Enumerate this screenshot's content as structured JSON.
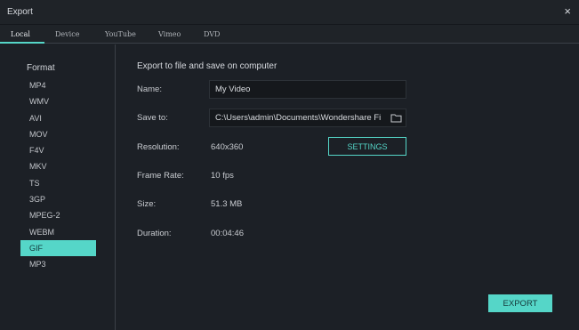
{
  "window": {
    "title": "Export",
    "close_glyph": "×"
  },
  "tabs": [
    {
      "label": "Local",
      "active": true
    },
    {
      "label": "Device",
      "active": false
    },
    {
      "label": "YouTube",
      "active": false
    },
    {
      "label": "Vimeo",
      "active": false
    },
    {
      "label": "DVD",
      "active": false
    }
  ],
  "sidebar": {
    "heading": "Format",
    "formats": [
      "MP4",
      "WMV",
      "AVI",
      "MOV",
      "F4V",
      "MKV",
      "TS",
      "3GP",
      "MPEG-2",
      "WEBM",
      "GIF",
      "MP3"
    ],
    "selected": "GIF"
  },
  "main": {
    "section_title": "Export to file and save on computer",
    "name": {
      "label": "Name:",
      "value": "My Video"
    },
    "save_to": {
      "label": "Save to:",
      "value": "C:\\Users\\admin\\Documents\\Wondershare Fil"
    },
    "resolution": {
      "label": "Resolution:",
      "value": "640x360"
    },
    "settings_label": "SETTINGS",
    "frame_rate": {
      "label": "Frame Rate:",
      "value": "10 fps"
    },
    "size": {
      "label": "Size:",
      "value": "51.3 MB"
    },
    "duration": {
      "label": "Duration:",
      "value": "00:04:46"
    },
    "export_label": "EXPORT"
  },
  "colors": {
    "accent": "#55d6c8",
    "background": "#1c2026",
    "field_bg": "#15181c"
  },
  "icons": {
    "close": "close-icon",
    "folder": "folder-icon"
  }
}
